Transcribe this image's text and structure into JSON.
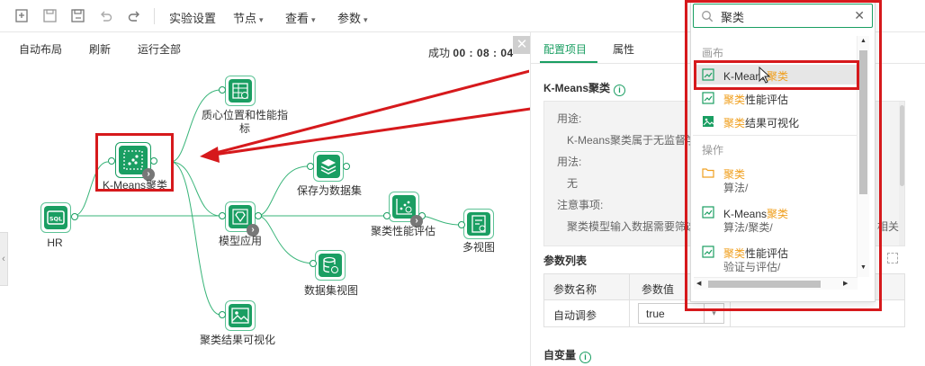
{
  "toolbar": {
    "menus": [
      {
        "label": "实验设置",
        "has_dropdown": false
      },
      {
        "label": "节点",
        "has_dropdown": true
      },
      {
        "label": "查看",
        "has_dropdown": true
      },
      {
        "label": "参数",
        "has_dropdown": true
      }
    ],
    "icons": [
      "new-file-icon",
      "save-icon",
      "save-as-icon",
      "undo-icon",
      "redo-icon"
    ]
  },
  "subtoolbar": {
    "auto_layout": "自动布局",
    "refresh": "刷新",
    "run_all": "运行全部",
    "status_prefix": "成功",
    "status_time": "00 : 08 : 04"
  },
  "canvas": {
    "nodes": {
      "hr": "HR",
      "kmeans": "K-Means聚类",
      "centroid_line1": "质心位置和性能指",
      "centroid_line2": "标",
      "save_dataset": "保存为数据集",
      "model_apply": "模型应用",
      "cluster_eval": "聚类性能评估",
      "multi_view": "多视图",
      "dataset_view": "数据集视图",
      "cluster_viz": "聚类结果可视化"
    },
    "colors": {
      "node": "#1a9e62",
      "edge": "#3ab57a",
      "annotation": "#d6191c"
    }
  },
  "right_panel": {
    "tabs": [
      "配置项目",
      "属性"
    ],
    "active_tab": "配置项目",
    "node_title": "K-Means聚类",
    "description": {
      "usage_label": "用途:",
      "usage_text": "K-Means聚类属于无监督学",
      "method_label": "用法:",
      "method_text": "无",
      "notes_label": "注意事项:",
      "notes_text": "聚类模型输入数据需要筛选",
      "notes_tail": "相关"
    },
    "params_title": "参数列表",
    "params_table": {
      "headers": [
        "参数名称",
        "参数值"
      ],
      "rows": [
        {
          "name": "自动调参",
          "value": "true"
        }
      ]
    },
    "variables_title": "自变量"
  },
  "search": {
    "value": "聚类",
    "placeholder": "",
    "groups": [
      {
        "title": "画布",
        "items": [
          {
            "before": "K-Means",
            "match": "聚类",
            "after": "",
            "path": ""
          },
          {
            "before": "",
            "match": "聚类",
            "after": "性能评估",
            "path": ""
          },
          {
            "before": "",
            "match": "聚类",
            "after": "结果可视化",
            "path": ""
          }
        ]
      },
      {
        "title": "操作",
        "items": [
          {
            "before": "",
            "match": "聚类",
            "after": "",
            "path": "算法/"
          },
          {
            "before": "K-Means",
            "match": "聚类",
            "after": "",
            "path": "算法/聚类/"
          },
          {
            "before": "",
            "match": "聚类",
            "after": "性能评估",
            "path": "验证与评估/"
          }
        ]
      }
    ],
    "highlight_color": "#f0a020"
  }
}
